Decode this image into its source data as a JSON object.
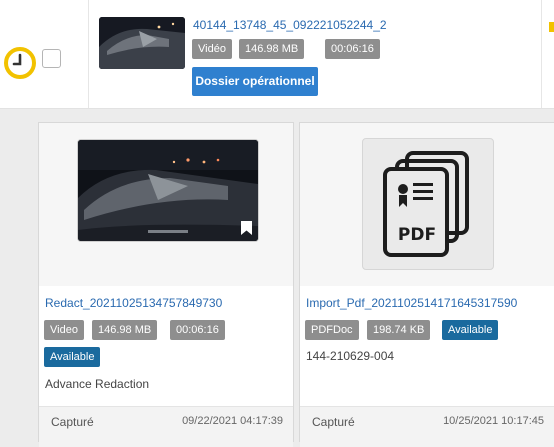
{
  "top_item": {
    "title": "40144_13748_45_092221052244_2",
    "type_badge": "Vidéo",
    "size_badge": "146.98 MB",
    "duration_badge": "00:06:16",
    "dossier_button": "Dossier opérationnel"
  },
  "cards": [
    {
      "title": "Redact_20211025134757849730",
      "type_badge": "Video",
      "size_badge": "146.98 MB",
      "duration_badge": "00:06:16",
      "status_badge": "Available",
      "description": "Advance Redaction",
      "footer_label": "Capturé",
      "footer_date": "09/22/2021 04:17:39"
    },
    {
      "title": "Import_Pdf_20211025141716453175​90",
      "type_badge": "PDFDoc",
      "size_badge": "198.74 KB",
      "status_badge": "Available",
      "description": "144-210629-004",
      "footer_label": "Capturé",
      "footer_date": "10/25/2021 10:17:45",
      "icon_label": "PDF"
    }
  ],
  "colors": {
    "link": "#2a6ab0",
    "grey_badge": "#8e8e8e",
    "available_badge": "#1a6a9e",
    "dossier_button": "#2f80cf",
    "spinner": "#f2c200"
  }
}
